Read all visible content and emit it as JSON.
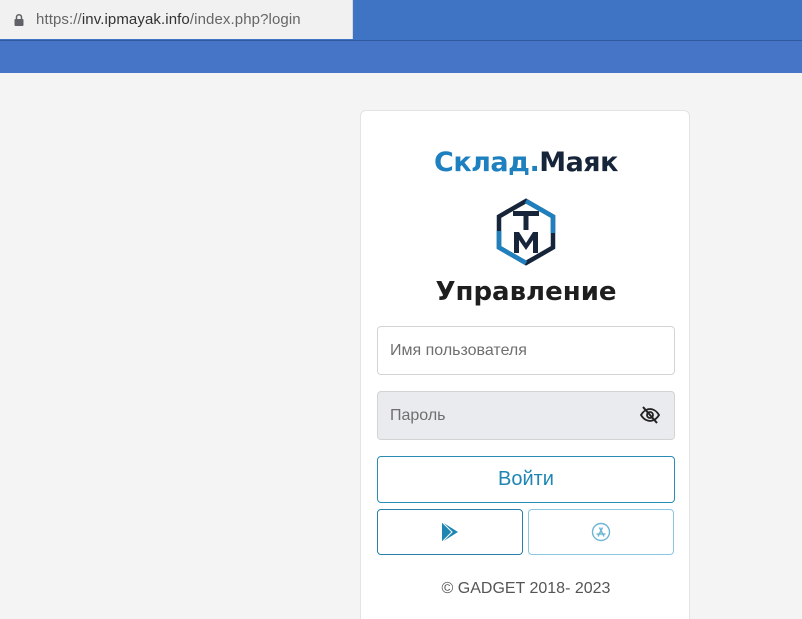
{
  "browser": {
    "url_scheme": "https://",
    "url_domain": "inv.ipmayak.info",
    "url_path": "/index.php?login",
    "lock_icon": "lock-icon"
  },
  "colors": {
    "nav_blue": "#4674c7",
    "brand_blue": "#1f80bf",
    "brand_dark": "#17253a",
    "accent": "#1f86b3"
  },
  "login": {
    "brand_part1": "Склад.",
    "brand_part2": "Маяк",
    "logo_icon": "hexagon-tm-logo-icon",
    "title": "Управление",
    "username_placeholder": "Имя пользователя",
    "password_placeholder": "Пароль",
    "password_toggle_icon": "eye-slash-icon",
    "submit_label": "Войти",
    "store_buttons": [
      {
        "icon": "google-play-icon"
      },
      {
        "icon": "app-store-icon"
      }
    ],
    "footer": "© GADGET 2018- 2023"
  }
}
